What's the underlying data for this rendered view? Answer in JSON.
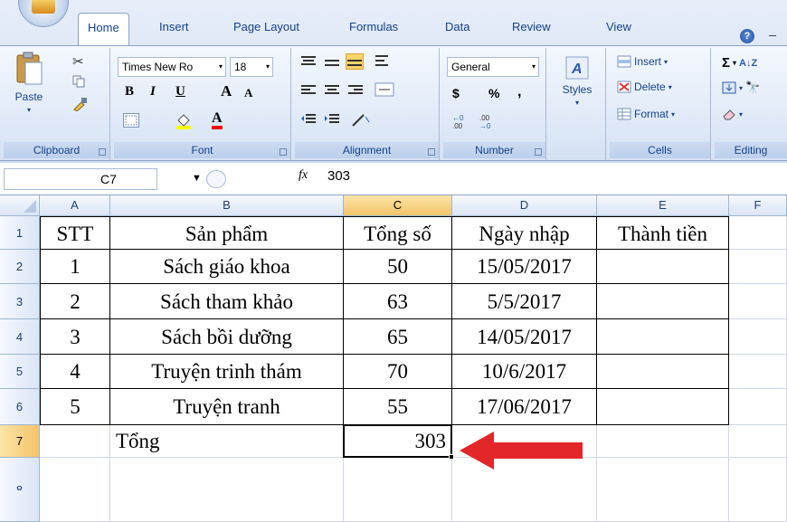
{
  "tabs": [
    "Home",
    "Insert",
    "Page Layout",
    "Formulas",
    "Data",
    "Review",
    "View"
  ],
  "help_label": "?",
  "ribbon": {
    "clipboard": {
      "label": "Clipboard",
      "paste": "Paste"
    },
    "font": {
      "label": "Font",
      "name": "Times New Ro",
      "size": "18",
      "bold": "B",
      "italic": "I",
      "underline": "U",
      "grow": "A",
      "shrink": "A"
    },
    "alignment": {
      "label": "Alignment"
    },
    "number": {
      "label": "Number",
      "format": "General",
      "currency": "$",
      "percent": "%",
      "comma": ","
    },
    "styles": {
      "label": "Styles"
    },
    "cells": {
      "label": "Cells",
      "insert": "Insert",
      "delete": "Delete",
      "format": "Format"
    },
    "editing": {
      "label": "Editing",
      "sum": "Σ"
    }
  },
  "formula_bar": {
    "name_box": "C7",
    "fx": "fx",
    "value": "303"
  },
  "columns": [
    "A",
    "B",
    "C",
    "D",
    "E",
    "F"
  ],
  "rows": [
    "1",
    "2",
    "3",
    "4",
    "5",
    "6",
    "7",
    "8"
  ],
  "table": {
    "headers": [
      "STT",
      "Sản phẩm",
      "Tổng số",
      "Ngày nhập",
      "Thành tiền"
    ],
    "data": [
      [
        "1",
        "Sách giáo khoa",
        "50",
        "15/05/2017",
        ""
      ],
      [
        "2",
        "Sách tham khảo",
        "63",
        "5/5/2017",
        ""
      ],
      [
        "3",
        "Sách bồi dưỡng",
        "65",
        "14/05/2017",
        ""
      ],
      [
        "4",
        "Truyện trinh thám",
        "70",
        "10/6/2017",
        ""
      ],
      [
        "5",
        "Truyện tranh",
        "55",
        "17/06/2017",
        ""
      ]
    ],
    "total_label": "Tổng",
    "total_value": "303"
  },
  "colors": {
    "arrow": "#e3262a",
    "selection": "#000000"
  }
}
